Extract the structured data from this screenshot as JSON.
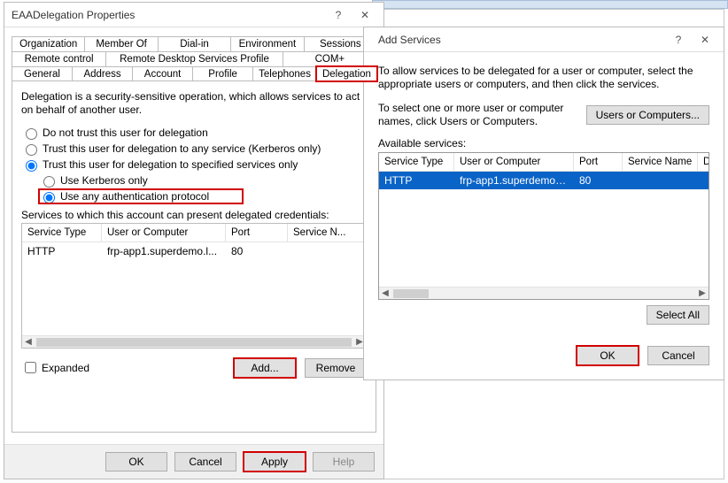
{
  "left": {
    "title": "EAADelegation Properties",
    "tabs_row1": [
      "Organization",
      "Member Of",
      "Dial-in",
      "Environment",
      "Sessions"
    ],
    "tabs_row2": [
      "Remote control",
      "Remote Desktop Services Profile",
      "COM+"
    ],
    "tabs_row3": [
      "General",
      "Address",
      "Account",
      "Profile",
      "Telephones",
      "Delegation"
    ],
    "intro": "Delegation is a security-sensitive operation, which allows services to act on behalf of another user.",
    "radio_no_trust": "Do not trust this user for delegation",
    "radio_any": "Trust this user for delegation to any service (Kerberos only)",
    "radio_specified": "Trust this user for delegation to specified services only",
    "sub_kerb": "Use Kerberos only",
    "sub_any_auth": "Use any authentication protocol",
    "list_label": "Services to which this account can present delegated credentials:",
    "cols": {
      "svc": "Service Type",
      "uc": "User or Computer",
      "port": "Port",
      "sn": "Service N..."
    },
    "row0": {
      "svc": "HTTP",
      "uc": "frp-app1.superdemo.l...",
      "port": "80"
    },
    "expanded": "Expanded",
    "add": "Add...",
    "remove": "Remove",
    "ok": "OK",
    "cancel": "Cancel",
    "apply": "Apply",
    "help": "Help"
  },
  "right": {
    "title": "Add Services",
    "intro": "To allow services to be delegated for a user or computer, select the appropriate users or computers, and then click the services.",
    "select_hint": "To select one or more user or computer names, click Users or Computers.",
    "uc_btn": "Users or Computers...",
    "avail": "Available services:",
    "cols": {
      "svc": "Service Type",
      "uc": "User or Computer",
      "port": "Port",
      "sn": "Service Name",
      "d": "D"
    },
    "row0": {
      "svc": "HTTP",
      "uc": "frp-app1.superdemo.l...",
      "port": "80"
    },
    "select_all": "Select All",
    "ok": "OK",
    "cancel": "Cancel"
  }
}
